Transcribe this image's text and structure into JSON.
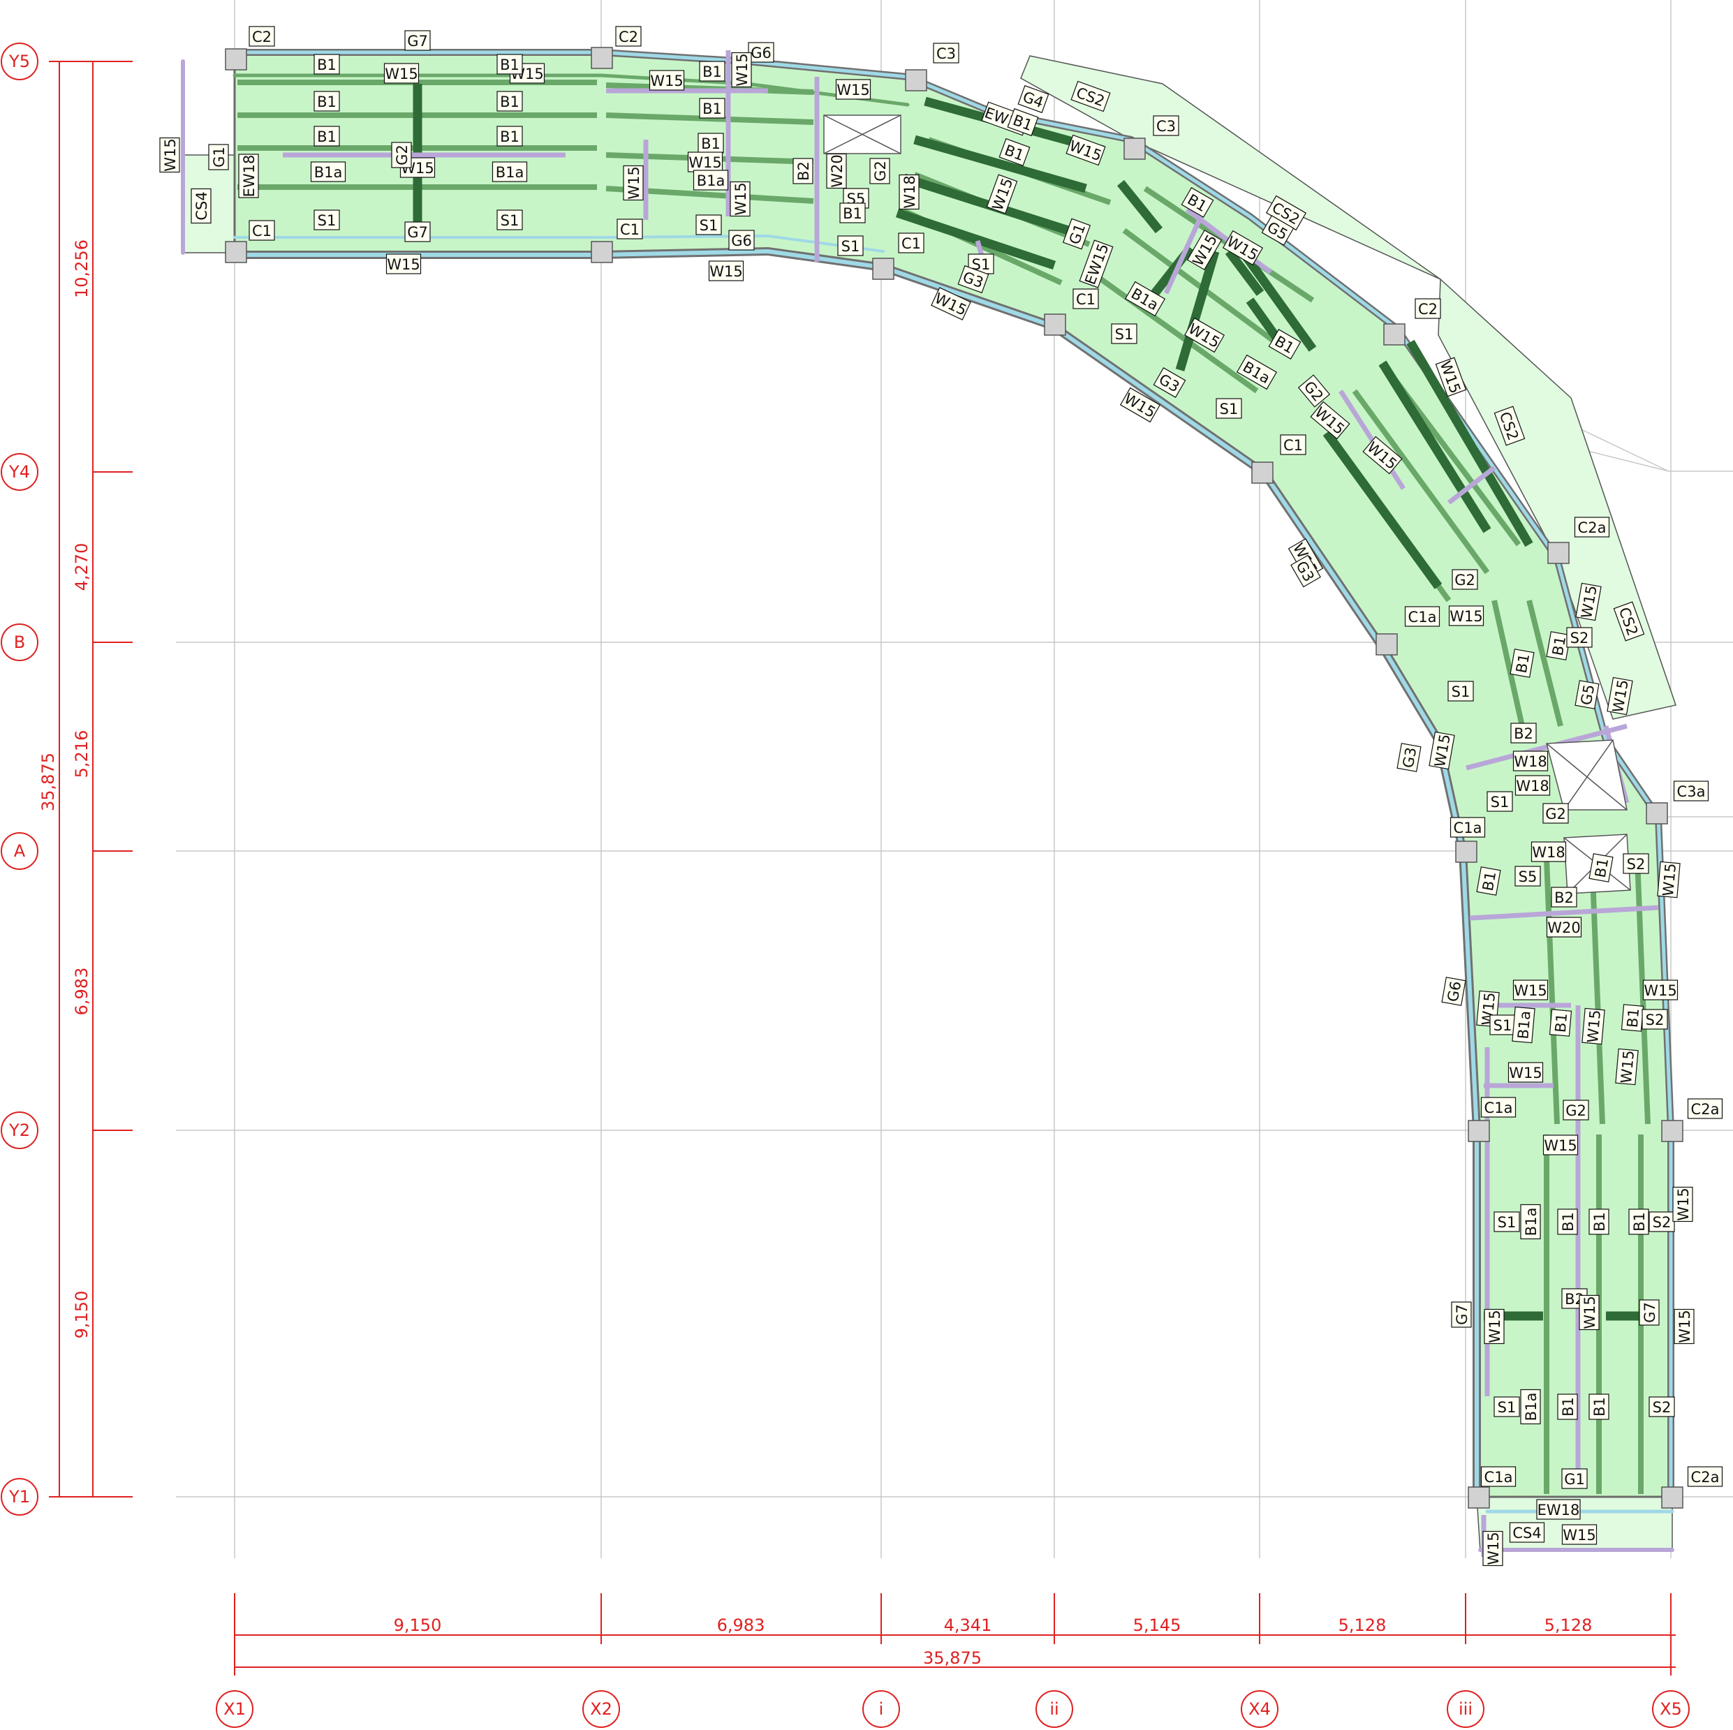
{
  "grid": {
    "x_axes": [
      "X1",
      "X2",
      "i",
      "ii",
      "X4",
      "iii",
      "X5"
    ],
    "y_axes": [
      "Y5",
      "Y4",
      "B",
      "A",
      "Y2",
      "Y1"
    ]
  },
  "dimensions": {
    "x_spans": [
      "9,150",
      "6,983",
      "4,341",
      "5,145",
      "5,128",
      "5,128"
    ],
    "x_total": "35,875",
    "y_spans": [
      "10,256",
      "4,270",
      "5,216",
      "6,983",
      "9,150"
    ],
    "y_total": "35,875"
  },
  "colors": {
    "grid_line": "#c8c8c8",
    "dimension": "#e02020",
    "slab_fill": "#c8f5c8",
    "cantilever_fill": "#e0fbe0",
    "beam_dark": "#2e6b36",
    "beam_mid": "#6aa86a",
    "edge_beam": "#9fd9e6",
    "brace": "#b9a6d8",
    "column": "#d2d2d2"
  },
  "member_labels": [
    {
      "id": "l1",
      "text": "C2"
    },
    {
      "id": "l2",
      "text": "G7"
    },
    {
      "id": "l3",
      "text": "B1"
    },
    {
      "id": "l4",
      "text": "W15"
    },
    {
      "id": "l5",
      "text": "W15"
    },
    {
      "id": "l6",
      "text": "B1"
    },
    {
      "id": "l7",
      "text": "B1"
    },
    {
      "id": "l8",
      "text": "B1"
    },
    {
      "id": "l9",
      "text": "B1"
    },
    {
      "id": "l10",
      "text": "B1"
    },
    {
      "id": "l11",
      "text": "G1"
    },
    {
      "id": "l12",
      "text": "W15"
    },
    {
      "id": "l13",
      "text": "EW18"
    },
    {
      "id": "l14",
      "text": "CS4"
    },
    {
      "id": "l15",
      "text": "B1a"
    },
    {
      "id": "l16",
      "text": "W15"
    },
    {
      "id": "l17",
      "text": "B1a"
    },
    {
      "id": "l18",
      "text": "G2"
    },
    {
      "id": "l19",
      "text": "S1"
    },
    {
      "id": "l20",
      "text": "S1"
    },
    {
      "id": "l21",
      "text": "C1"
    },
    {
      "id": "l22",
      "text": "G7"
    },
    {
      "id": "l23",
      "text": "W15"
    },
    {
      "id": "l24",
      "text": "C2"
    },
    {
      "id": "l25",
      "text": "W15"
    },
    {
      "id": "l26",
      "text": "B1"
    },
    {
      "id": "l27",
      "text": "G6"
    },
    {
      "id": "l28",
      "text": "W15"
    },
    {
      "id": "l29",
      "text": "B1"
    },
    {
      "id": "l30",
      "text": "B1"
    },
    {
      "id": "l31",
      "text": "W15"
    },
    {
      "id": "l32",
      "text": "B1a"
    },
    {
      "id": "l33",
      "text": "W15"
    },
    {
      "id": "l34",
      "text": "W15"
    },
    {
      "id": "l35",
      "text": "B2"
    },
    {
      "id": "l36",
      "text": "S1"
    },
    {
      "id": "l37",
      "text": "C1"
    },
    {
      "id": "l38",
      "text": "G6"
    },
    {
      "id": "l39",
      "text": "W15"
    },
    {
      "id": "l40",
      "text": "W15"
    },
    {
      "id": "l41",
      "text": "W20"
    },
    {
      "id": "l42",
      "text": "G2"
    },
    {
      "id": "l43",
      "text": "S5"
    },
    {
      "id": "l44",
      "text": "B1"
    },
    {
      "id": "l45",
      "text": "S1"
    },
    {
      "id": "l46",
      "text": "C3"
    },
    {
      "id": "l47",
      "text": "CS2"
    },
    {
      "id": "l48",
      "text": "G4"
    },
    {
      "id": "l49",
      "text": "EW15"
    },
    {
      "id": "l50",
      "text": "B1"
    },
    {
      "id": "l51",
      "text": "W15"
    },
    {
      "id": "l52",
      "text": "C3"
    },
    {
      "id": "l53",
      "text": "W18"
    },
    {
      "id": "l54",
      "text": "B1"
    },
    {
      "id": "l55",
      "text": "W15"
    },
    {
      "id": "l56",
      "text": "C1"
    },
    {
      "id": "l57",
      "text": "S1"
    },
    {
      "id": "l58",
      "text": "G3"
    },
    {
      "id": "l59",
      "text": "W15"
    },
    {
      "id": "l60",
      "text": "G1"
    },
    {
      "id": "l61",
      "text": "EW15"
    },
    {
      "id": "l62",
      "text": "C1"
    },
    {
      "id": "l63",
      "text": "B1"
    },
    {
      "id": "l64",
      "text": "CS2"
    },
    {
      "id": "l65",
      "text": "G5"
    },
    {
      "id": "l66",
      "text": "W15"
    },
    {
      "id": "l67",
      "text": "W15"
    },
    {
      "id": "l68",
      "text": "B1a"
    },
    {
      "id": "l69",
      "text": "S1"
    },
    {
      "id": "l70",
      "text": "W15"
    },
    {
      "id": "l71",
      "text": "B1"
    },
    {
      "id": "l72",
      "text": "B1a"
    },
    {
      "id": "l73",
      "text": "G3"
    },
    {
      "id": "l74",
      "text": "S1"
    },
    {
      "id": "l75",
      "text": "W15"
    },
    {
      "id": "l76",
      "text": "C2"
    },
    {
      "id": "l77",
      "text": "W15"
    },
    {
      "id": "l78",
      "text": "CS2"
    },
    {
      "id": "l79",
      "text": "G2"
    },
    {
      "id": "l80",
      "text": "C1"
    },
    {
      "id": "l81",
      "text": "W15"
    },
    {
      "id": "l82",
      "text": "W15"
    },
    {
      "id": "l83",
      "text": "W15"
    },
    {
      "id": "l84",
      "text": "G3"
    },
    {
      "id": "l85",
      "text": "C2a"
    },
    {
      "id": "l86",
      "text": "G2"
    },
    {
      "id": "l87",
      "text": "C1a"
    },
    {
      "id": "l88",
      "text": "W15"
    },
    {
      "id": "l89",
      "text": "B1"
    },
    {
      "id": "l90",
      "text": "B1"
    },
    {
      "id": "l91",
      "text": "S2"
    },
    {
      "id": "l92",
      "text": "CS2"
    },
    {
      "id": "l93",
      "text": "W15"
    },
    {
      "id": "l94",
      "text": "S1"
    },
    {
      "id": "l95",
      "text": "G5"
    },
    {
      "id": "l96",
      "text": "W15"
    },
    {
      "id": "l97",
      "text": "G3"
    },
    {
      "id": "l98",
      "text": "W15"
    },
    {
      "id": "l99",
      "text": "B2"
    },
    {
      "id": "l100",
      "text": "W18"
    },
    {
      "id": "l101",
      "text": "W18"
    },
    {
      "id": "l102",
      "text": "S1"
    },
    {
      "id": "l103",
      "text": "G2"
    },
    {
      "id": "l104",
      "text": "C3a"
    },
    {
      "id": "l105",
      "text": "C1a"
    },
    {
      "id": "l106",
      "text": "W18"
    },
    {
      "id": "l107",
      "text": "B1"
    },
    {
      "id": "l108",
      "text": "S5"
    },
    {
      "id": "l109",
      "text": "B1"
    },
    {
      "id": "l110",
      "text": "S2"
    },
    {
      "id": "l111",
      "text": "W15"
    },
    {
      "id": "l112",
      "text": "B2"
    },
    {
      "id": "l113",
      "text": "W20"
    },
    {
      "id": "l114",
      "text": "G6"
    },
    {
      "id": "l115",
      "text": "W15"
    },
    {
      "id": "l116",
      "text": "W15"
    },
    {
      "id": "l117",
      "text": "S1"
    },
    {
      "id": "l118",
      "text": "B1a"
    },
    {
      "id": "l119",
      "text": "B1"
    },
    {
      "id": "l120",
      "text": "W15"
    },
    {
      "id": "l121",
      "text": "B1"
    },
    {
      "id": "l122",
      "text": "S2"
    },
    {
      "id": "l123",
      "text": "W15"
    },
    {
      "id": "l124",
      "text": "W15"
    },
    {
      "id": "l125",
      "text": "W15"
    },
    {
      "id": "l126",
      "text": "C1a"
    },
    {
      "id": "l127",
      "text": "G2"
    },
    {
      "id": "l128",
      "text": "C2a"
    },
    {
      "id": "l129",
      "text": "W15"
    },
    {
      "id": "l130",
      "text": "S1"
    },
    {
      "id": "l131",
      "text": "B1a"
    },
    {
      "id": "l132",
      "text": "B1"
    },
    {
      "id": "l133",
      "text": "B1"
    },
    {
      "id": "l134",
      "text": "B1"
    },
    {
      "id": "l135",
      "text": "S2"
    },
    {
      "id": "l136",
      "text": "W15"
    },
    {
      "id": "l137",
      "text": "G7"
    },
    {
      "id": "l138",
      "text": "W15"
    },
    {
      "id": "l139",
      "text": "B2"
    },
    {
      "id": "l140",
      "text": "W15"
    },
    {
      "id": "l141",
      "text": "G7"
    },
    {
      "id": "l142",
      "text": "W15"
    },
    {
      "id": "l143",
      "text": "S1"
    },
    {
      "id": "l144",
      "text": "B1a"
    },
    {
      "id": "l145",
      "text": "B1"
    },
    {
      "id": "l146",
      "text": "B1"
    },
    {
      "id": "l147",
      "text": "S2"
    },
    {
      "id": "l148",
      "text": "C1a"
    },
    {
      "id": "l149",
      "text": "G1"
    },
    {
      "id": "l150",
      "text": "C2a"
    },
    {
      "id": "l151",
      "text": "EW18"
    },
    {
      "id": "l152",
      "text": "CS4"
    },
    {
      "id": "l153",
      "text": "W15"
    },
    {
      "id": "l154",
      "text": "W15"
    }
  ]
}
